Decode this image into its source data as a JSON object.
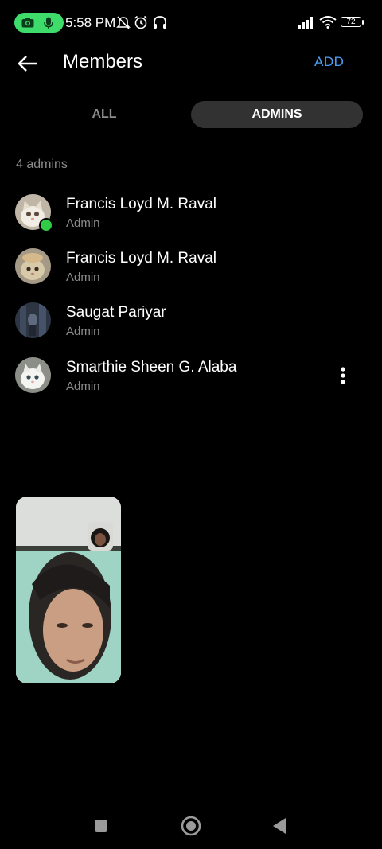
{
  "status_bar": {
    "time": "5:58 PM",
    "battery": "72",
    "icons": [
      "camera-icon",
      "mic-icon",
      "bell-off-icon",
      "alarm-icon",
      "headphones-icon",
      "signal-icon",
      "wifi-icon",
      "battery-icon"
    ],
    "call_pill_color": "#3ddc6b"
  },
  "header": {
    "title": "Members",
    "add_label": "ADD",
    "back_icon": "arrow-left-icon"
  },
  "tabs": [
    {
      "label": "ALL",
      "active": false
    },
    {
      "label": "ADMINS",
      "active": true
    }
  ],
  "admin_count_label": "4 admins",
  "members": [
    {
      "name": "Francis Loyd M. Raval",
      "role": "Admin",
      "online": true
    },
    {
      "name": "Francis Loyd M. Raval",
      "role": "Admin",
      "online": false
    },
    {
      "name": "Saugat Pariyar",
      "role": "Admin",
      "online": false
    },
    {
      "name": "Smarthie Sheen G. Alaba",
      "role": "Admin",
      "online": false
    }
  ],
  "nav_bar": {
    "icons": [
      "recents-square-icon",
      "home-circle-icon",
      "back-triangle-icon"
    ]
  },
  "colors": {
    "accent": "#4a9ff5",
    "online": "#31cc46",
    "muted_text": "#8c8c8c",
    "active_tab_bg": "#323232"
  }
}
